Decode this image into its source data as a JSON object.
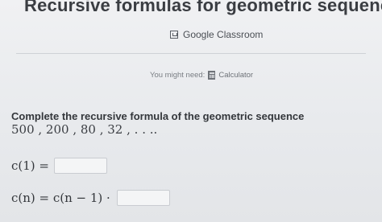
{
  "header": {
    "title": "Recursive formulas for geometric sequence"
  },
  "google_classroom": {
    "label": "Google Classroom",
    "icon": "google-classroom-icon"
  },
  "help": {
    "prefix": "You might need:",
    "tool_label": "Calculator",
    "tool_icon": "calculator-icon"
  },
  "problem": {
    "prompt": "Complete the recursive formula of the geometric sequence",
    "sequence": "500 , 200 , 80 , 32 , . . ..",
    "eq1_lhs": "c(1) =",
    "eq2_lhs": "c(n) = c(n − 1) ·",
    "answer1_value": "",
    "answer2_value": ""
  }
}
